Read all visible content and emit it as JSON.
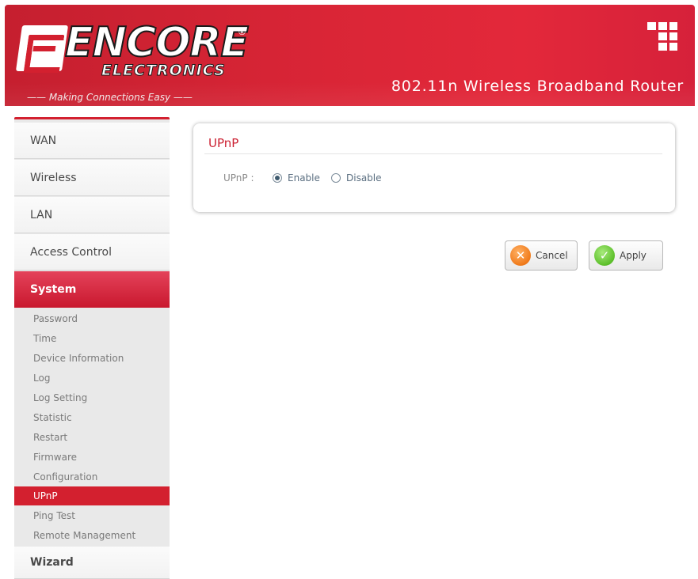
{
  "header": {
    "brand": "ENCORE",
    "brand_sub": "ELECTRONICS",
    "registered": "®",
    "tagline": "—— Making Connections Easy ——",
    "product": "802.11n Wireless Broadband Router"
  },
  "sidebar": {
    "items": [
      {
        "label": "WAN"
      },
      {
        "label": "Wireless"
      },
      {
        "label": "LAN"
      },
      {
        "label": "Access Control"
      },
      {
        "label": "System"
      }
    ],
    "system_items": [
      {
        "label": "Password"
      },
      {
        "label": "Time"
      },
      {
        "label": "Device Information"
      },
      {
        "label": "Log"
      },
      {
        "label": "Log Setting"
      },
      {
        "label": "Statistic"
      },
      {
        "label": "Restart"
      },
      {
        "label": "Firmware"
      },
      {
        "label": "Configuration"
      },
      {
        "label": "UPnP"
      },
      {
        "label": "Ping Test"
      },
      {
        "label": "Remote Management"
      }
    ],
    "wizard": "Wizard"
  },
  "panel": {
    "title": "UPnP",
    "field_label": "UPnP :",
    "option_enable": "Enable",
    "option_disable": "Disable",
    "selected": "Enable"
  },
  "buttons": {
    "cancel": "Cancel",
    "apply": "Apply"
  },
  "colors": {
    "brand_red": "#d3202f",
    "title_red": "#cc2233"
  }
}
